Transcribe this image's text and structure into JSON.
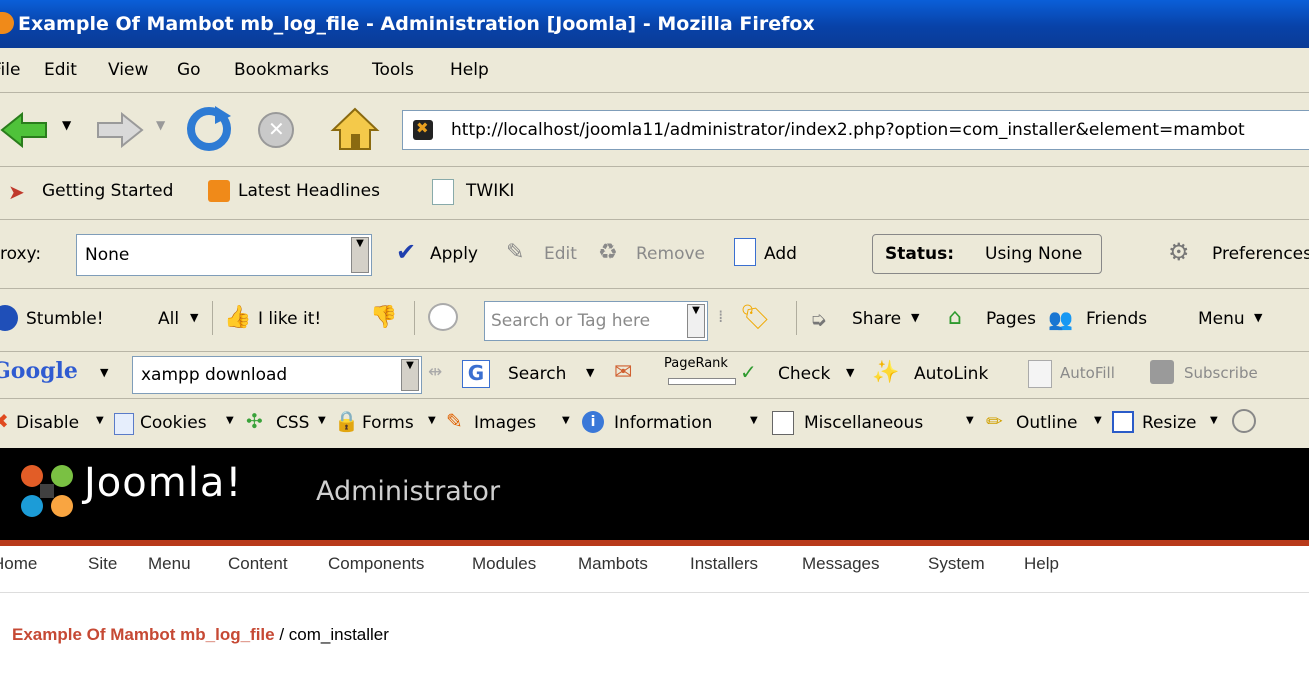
{
  "window": {
    "title": "Example Of Mambot mb_log_file - Administration [Joomla] - Mozilla Firefox"
  },
  "menubar": [
    "File",
    "Edit",
    "View",
    "Go",
    "Bookmarks",
    "Tools",
    "Help"
  ],
  "navigation": {
    "url": "http://localhost/joomla11/administrator/index2.php?option=com_installer&element=mambot"
  },
  "bookmarks": [
    "Getting Started",
    "Latest Headlines",
    "TWIKI"
  ],
  "proxy_bar": {
    "label": "Proxy:",
    "selected": "None",
    "apply": "Apply",
    "edit": "Edit",
    "remove": "Remove",
    "add": "Add",
    "status_label": "Status:",
    "status_value": "Using None",
    "preferences": "Preferences"
  },
  "stumble_bar": {
    "stumble": "Stumble!",
    "all": "All",
    "like": "I like it!",
    "search_placeholder": "Search or Tag here",
    "share": "Share",
    "pages": "Pages",
    "friends": "Friends",
    "menu": "Menu"
  },
  "google_bar": {
    "logo": "Google",
    "query": "xampp download",
    "search": "Search",
    "pagerank": "PageRank",
    "check": "Check",
    "autolink": "AutoLink",
    "autofill": "AutoFill",
    "subscribe": "Subscribe"
  },
  "webdev_bar": [
    "Disable",
    "Cookies",
    "CSS",
    "Forms",
    "Images",
    "Information",
    "Miscellaneous",
    "Outline",
    "Resize"
  ],
  "joomla": {
    "logo_text": "Joomla!",
    "admin_text": "Administrator",
    "menu": [
      "Home",
      "Site",
      "Menu",
      "Content",
      "Components",
      "Modules",
      "Mambots",
      "Installers",
      "Messages",
      "System",
      "Help"
    ],
    "breadcrumb_title": "Example Of Mambot mb_log_file",
    "breadcrumb_rest": " / com_installer"
  },
  "colors": {
    "joomla_red": "#c64934",
    "xp_blue": "#0842a8"
  }
}
